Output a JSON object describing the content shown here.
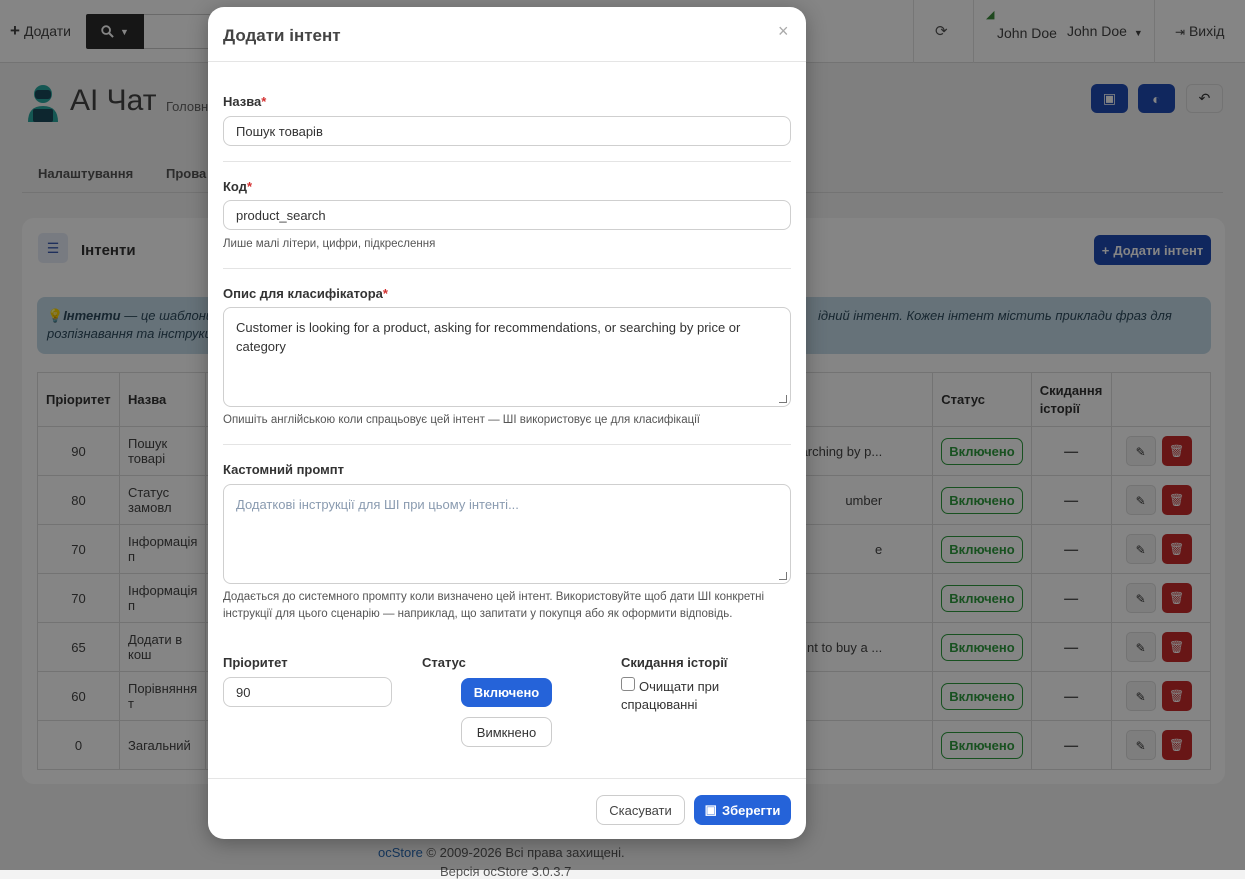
{
  "topbar": {
    "add_label": "Додати",
    "user_name": "John Doe",
    "user_menu": "John Doe",
    "logout": "Вихід"
  },
  "page": {
    "title": "AI Чат",
    "breadcrumb": "Головн",
    "tabs": [
      "Налаштування",
      "Прова"
    ]
  },
  "card": {
    "title": "Інтенти",
    "add_button": "Додати інтент",
    "info_bold": "Інтенти",
    "info_text": " — це шаблони н",
    "info_line2": "розпізнавання та інструкц",
    "info_right": "ідний інтент. Кожен інтент містить приклади фраз для"
  },
  "table": {
    "headers": [
      "Пріоритет",
      "Назва",
      "",
      "Статус",
      "Скидання історії",
      ""
    ],
    "rows": [
      {
        "priority": "90",
        "name": "Пошук товарі",
        "desc": "earching by p...",
        "status": "Включено"
      },
      {
        "priority": "80",
        "name": "Статус замовл",
        "desc": "umber",
        "status": "Включено"
      },
      {
        "priority": "70",
        "name": "Інформація п",
        "desc": "e",
        "status": "Включено"
      },
      {
        "priority": "70",
        "name": "Інформація п",
        "desc": "",
        "status": "Включено"
      },
      {
        "priority": "65",
        "name": "Додати в кош",
        "desc": "nt to buy a ...",
        "status": "Включено"
      },
      {
        "priority": "60",
        "name": "Порівняння т",
        "desc": "",
        "status": "Включено"
      },
      {
        "priority": "0",
        "name": "Загальний",
        "desc": "",
        "status": "Включено"
      }
    ],
    "reset_dash": "—"
  },
  "footer": {
    "brand": "ocStore",
    "copyright": " © 2009-2026 Всі права захищені.",
    "version": "Версія ocStore 3.0.3.7"
  },
  "modal": {
    "title": "Додати інтент",
    "close": "×",
    "name_label": "Назва",
    "name_value": "Пошук товарів",
    "code_label": "Код",
    "code_value": "product_search",
    "code_hint": "Лише малі літери, цифри, підкреслення",
    "desc_label": "Опис для класифікатора",
    "desc_value": "Customer is looking for a product, asking for recommendations, or searching by price or category",
    "desc_hint": "Опишіть англійською коли спрацьовує цей інтент — ШІ використовує це для класифікації",
    "prompt_label": "Кастомний промпт",
    "prompt_placeholder": "Додаткові інструкції для ШІ при цьому інтенті...",
    "prompt_hint": "Додається до системного промпту коли визначено цей інтент. Використовуйте щоб дати ШІ конкретні інструкції для цього сценарію — наприклад, що запитати у покупця або як оформити відповідь.",
    "priority_label": "Пріоритет",
    "priority_value": "90",
    "status_label": "Статус",
    "status_on": "Включено",
    "status_off": "Вимкнено",
    "reset_label": "Скидання історії",
    "reset_checkbox": "Очищати при спрацюванні",
    "cancel": "Скасувати",
    "save": "Зберегти"
  },
  "colors": {
    "primary": "#2563d9",
    "header_btn": "#1f4bb5",
    "danger": "#c72b2b",
    "success": "#2e9b3f",
    "info_bg": "#c4dbe9"
  }
}
